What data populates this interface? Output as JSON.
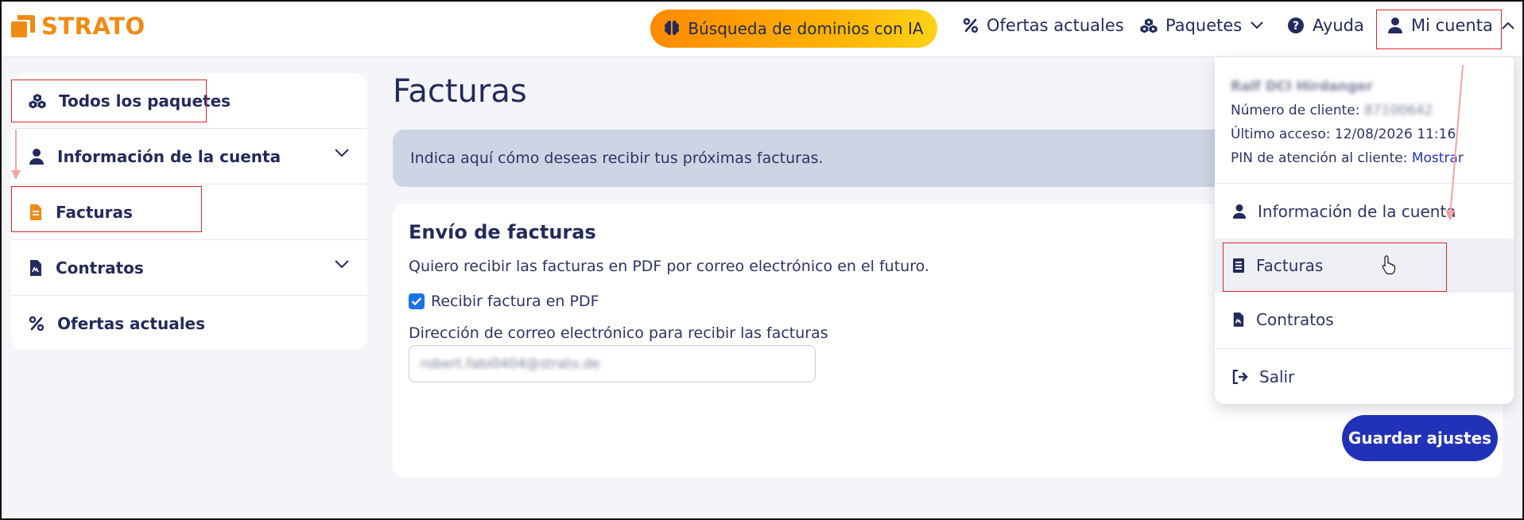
{
  "brand": {
    "name": "STRATO",
    "color": "#f08a10"
  },
  "header": {
    "ai_search": "Búsqueda de dominios con IA",
    "nav": {
      "offers": "Ofertas actuales",
      "packages": "Paquetes",
      "help": "Ayuda",
      "account": "Mi cuenta"
    }
  },
  "sidebar": {
    "items": [
      {
        "label": "Todos los paquetes",
        "icon": "packages-icon"
      },
      {
        "label": "Información de la cuenta",
        "icon": "user-icon",
        "expandable": true
      },
      {
        "label": "Facturas",
        "icon": "invoice-icon"
      },
      {
        "label": "Contratos",
        "icon": "contract-icon",
        "expandable": true
      },
      {
        "label": "Ofertas actuales",
        "icon": "percent-icon"
      }
    ]
  },
  "main": {
    "title": "Facturas",
    "banner": "Indica aquí cómo deseas recibir tus próximas facturas.",
    "card": {
      "title": "Envío de facturas",
      "description": "Quiero recibir las facturas en PDF por correo electrónico en el futuro.",
      "checkbox_label": "Recibir factura en PDF",
      "checkbox_checked": true,
      "email_label": "Dirección de correo electrónico para recibir las facturas",
      "email_value": "robert.fabi0404@strato.de",
      "save_label": "Guardar ajustes"
    }
  },
  "account_menu": {
    "name": "Ralf DCI Hirdanger",
    "customer_number_label": "Número de cliente:",
    "customer_number": "87100642",
    "last_access_label": "Último acceso:",
    "last_access": "12/08/2026 11:16",
    "pin_label": "PIN de atención al cliente:",
    "pin_action": "Mostrar",
    "items": [
      {
        "label": "Información de la cuenta",
        "icon": "user-icon"
      },
      {
        "label": "Facturas",
        "icon": "invoice-icon"
      },
      {
        "label": "Contratos",
        "icon": "contract-icon"
      },
      {
        "label": "Salir",
        "icon": "logout-icon"
      }
    ]
  }
}
